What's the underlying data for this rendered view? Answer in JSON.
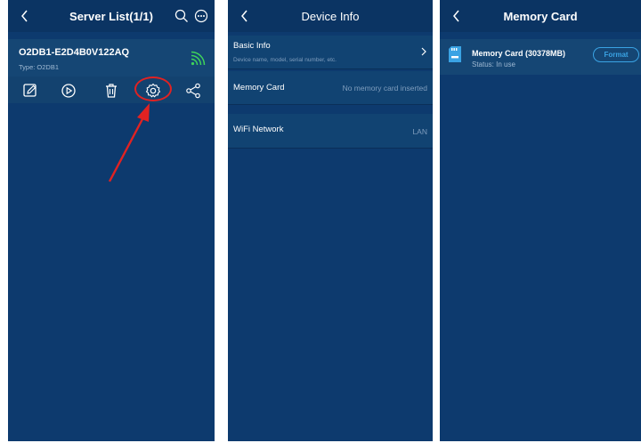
{
  "server_list": {
    "title": "Server List(1/1)",
    "device": {
      "name": "O2DB1-E2D4B0V122AQ",
      "type": "Type: O2DB1"
    },
    "actions": [
      "edit-icon",
      "play-icon",
      "trash-icon",
      "gear-icon",
      "share-icon"
    ],
    "highlighted_action": "gear-icon"
  },
  "device_info": {
    "title": "Device Info",
    "basic_info": {
      "label": "Basic Info",
      "sublabel": "Device name, model, serial number, etc."
    },
    "memory_card": {
      "label": "Memory Card",
      "value": "No memory card inserted"
    },
    "wifi": {
      "label": "WiFi Network",
      "value": "LAN"
    }
  },
  "memory_card_page": {
    "title": "Memory Card",
    "card": {
      "name": "Memory Card  (30378MB)",
      "status": "Status:  In use",
      "format_label": "Format"
    }
  },
  "colors": {
    "background": "#0d3a6e",
    "header": "#0b3463",
    "accent": "#3aa3e4",
    "signal": "#3fd35a",
    "highlight": "#e12222"
  }
}
